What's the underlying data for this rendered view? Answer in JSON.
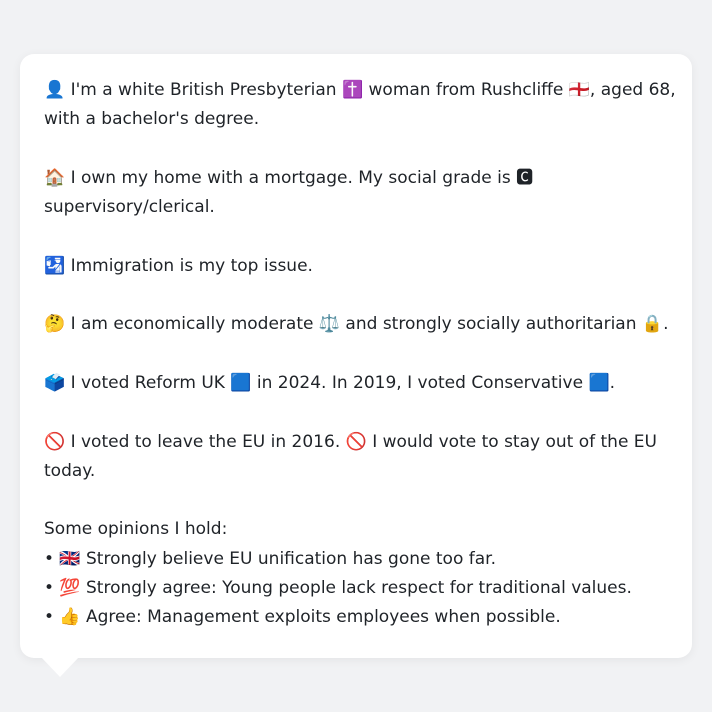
{
  "bio": {
    "line1": "👤 I'm a white British Presbyterian ✝️ woman from Rushcliffe 🏴󠁧󠁢󠁥󠁮󠁧󠁿, aged 68,",
    "line2": "with a bachelor's degree.",
    "line3": "🏠 I own my home with a mortgage. My social grade is 🅲",
    "line4": "supervisory/clerical.",
    "line5": "🛂 Immigration is my top issue.",
    "line6": "🤔 I am economically moderate ⚖️ and strongly socially authoritarian 🔒.",
    "line7": "🗳️ I voted Reform UK 🟦 in 2024. In 2019, I voted Conservative 🟦.",
    "line8": "🚫 I voted to leave the EU in 2016. 🚫 I would vote to stay out of the EU",
    "line9": "today."
  },
  "opinions": {
    "heading": "Some opinions I hold:",
    "items": [
      "• 🇬🇧 Strongly believe EU unification has gone too far.",
      "• 💯 Strongly agree: Young people lack respect for traditional values.",
      "• 👍 Agree: Management exploits employees when possible."
    ]
  }
}
